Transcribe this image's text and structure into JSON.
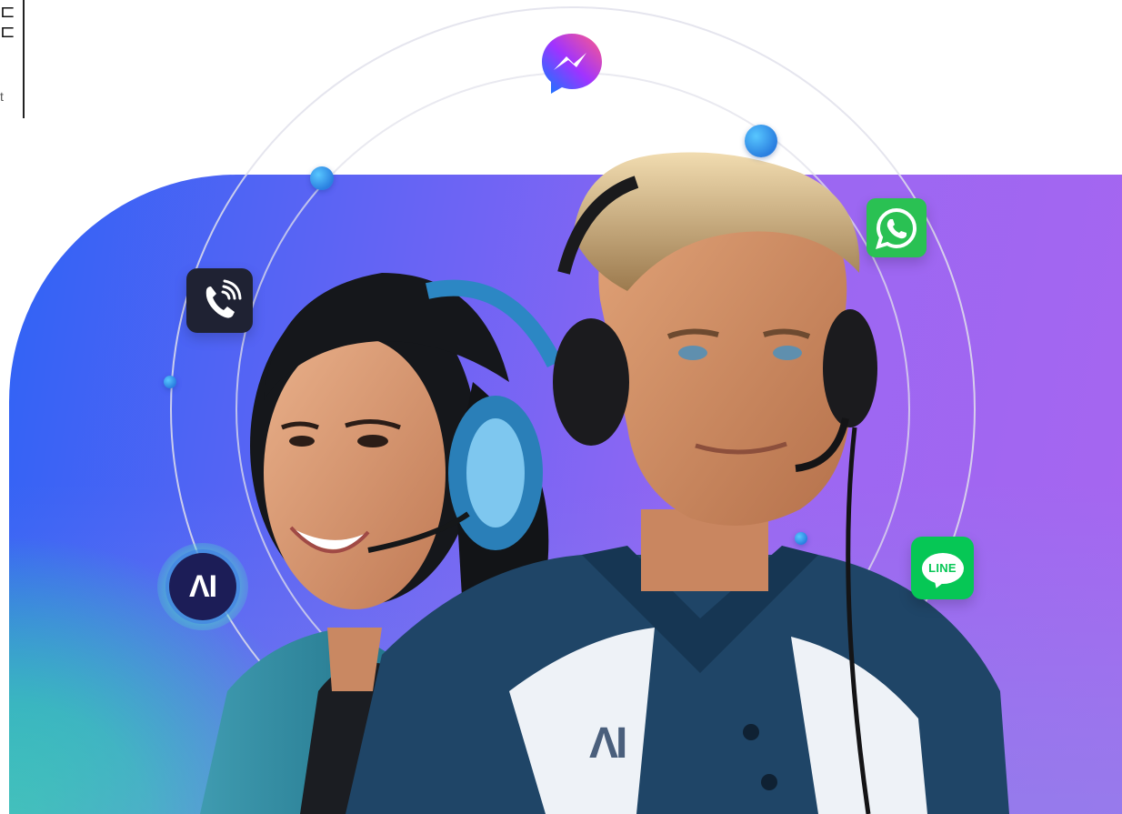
{
  "header_mark": {
    "glyph": "⊏\n⊏",
    "small": "t"
  },
  "badges": {
    "ai_label": "ΛI",
    "line_label": "LINE"
  },
  "shirt_logo": "ΛI",
  "icons": [
    "messenger-icon",
    "phone-call-icon",
    "whatsapp-icon",
    "line-icon",
    "ai-icon"
  ],
  "colors": {
    "gradient_blue": "#2f63f5",
    "gradient_purple": "#a766f0",
    "gradient_green": "#12e39a",
    "whatsapp_green": "#2ac153",
    "line_green": "#06c755",
    "call_tile": "#1f2233",
    "ai_navy": "#1c1d57"
  }
}
